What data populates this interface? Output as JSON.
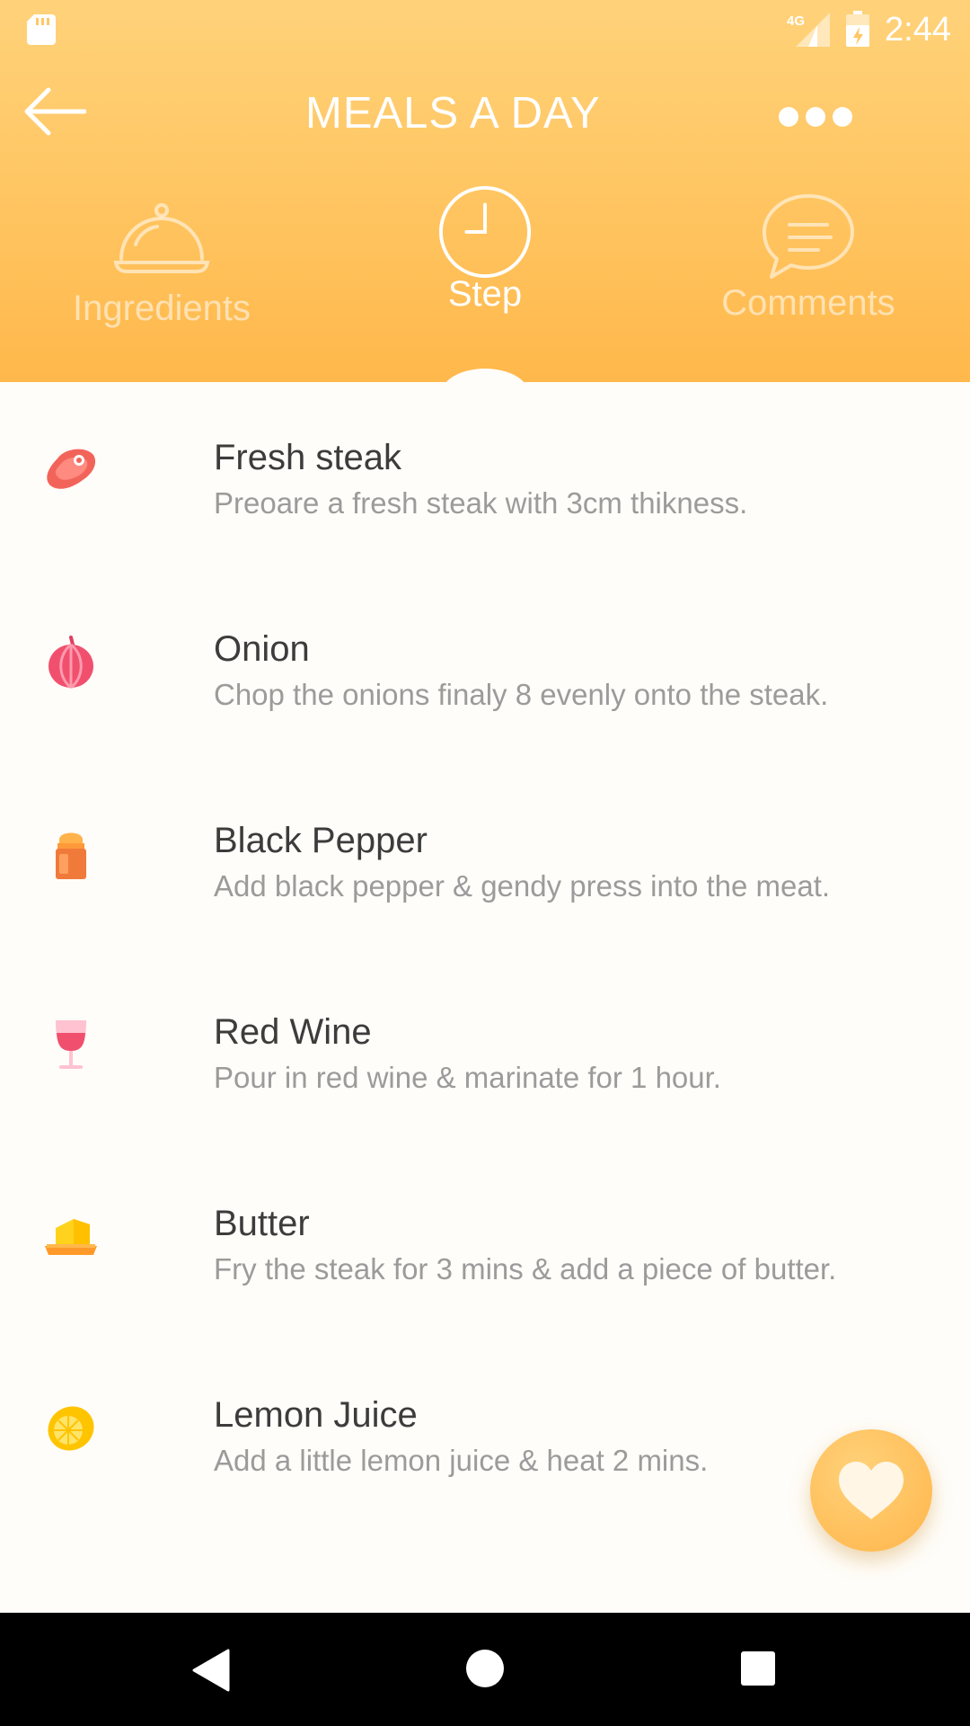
{
  "status_bar": {
    "network": "4G",
    "time": "2:44"
  },
  "app_bar": {
    "title": "MEALS A DAY",
    "back_icon": "arrow-left-icon",
    "more_icon": "more-dots-icon"
  },
  "tabs": [
    {
      "label": "Ingredients",
      "icon": "cloche-icon",
      "active": false
    },
    {
      "label": "Step",
      "icon": "clock-icon",
      "active": true
    },
    {
      "label": "Comments",
      "icon": "chat-bubble-icon",
      "active": false
    }
  ],
  "steps": [
    {
      "title": "Fresh steak",
      "description": "Preoare a fresh steak with 3cm thikness.",
      "icon": "steak-icon"
    },
    {
      "title": "Onion",
      "description": "Chop the onions finaly 8 evenly onto the steak.",
      "icon": "onion-icon"
    },
    {
      "title": "Black Pepper",
      "description": "Add black pepper & gendy press into the meat.",
      "icon": "pepper-shaker-icon"
    },
    {
      "title": "Red Wine",
      "description": "Pour in red wine & marinate for 1 hour.",
      "icon": "wine-glass-icon"
    },
    {
      "title": "Butter",
      "description": "Fry the steak for 3 mins & add a piece of butter.",
      "icon": "butter-icon"
    },
    {
      "title": "Lemon Juice",
      "description": "Add a little lemon juice & heat 2 mins.",
      "icon": "lemon-icon"
    }
  ],
  "fab": {
    "icon": "heart-icon"
  },
  "colors": {
    "header_top": "#FFD27A",
    "header_bottom": "#FFB84B",
    "title_text": "#3C3C3C",
    "description_text": "#9B9B9B",
    "background": "#FFFDF9"
  }
}
